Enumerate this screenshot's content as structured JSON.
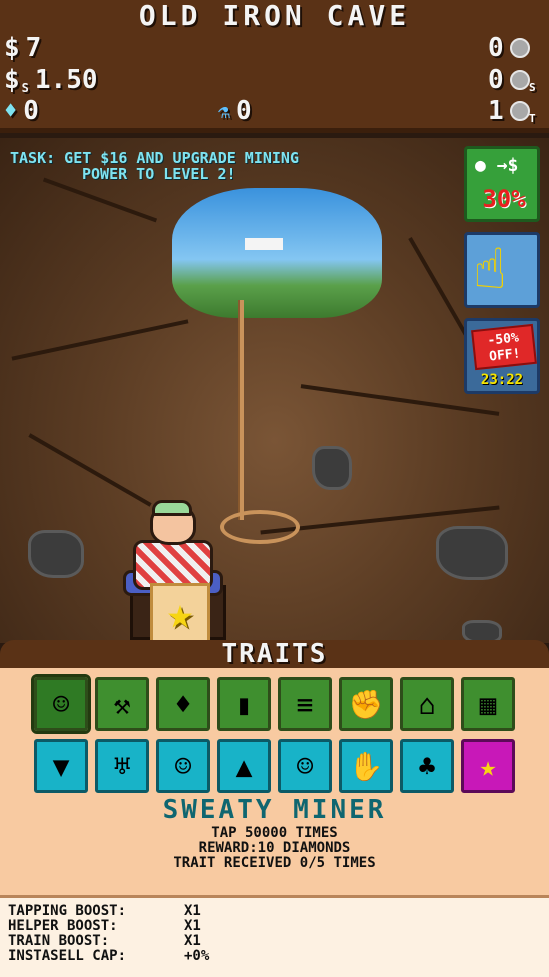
{
  "header": {
    "title": "OLD IRON CAVE"
  },
  "stats": {
    "money": {
      "symbol": "$",
      "value": "7"
    },
    "sell_price": {
      "symbol": "$",
      "sub": "S",
      "value": "1.50"
    },
    "diamonds": {
      "value": "0"
    },
    "potions": {
      "value": "0"
    },
    "ore": {
      "value": "0"
    },
    "ore_stored": {
      "value": "0",
      "sub": "S"
    },
    "ore_train": {
      "value": "1",
      "sub": "T"
    }
  },
  "task": {
    "line1": "TASK: GET $16 AND UPGRADE MINING",
    "line2": "POWER TO LEVEL 2!"
  },
  "side_buttons": {
    "sell_arrow": "→$",
    "sell_percent": "30%",
    "sale_tag": "-50%\nOFF!",
    "sale_timer": "23:22"
  },
  "traits": {
    "title": "TRAITS",
    "row1": [
      {
        "name": "sweaty-miner",
        "glyph": "☺",
        "color": "green",
        "selected": true
      },
      {
        "name": "pickaxe",
        "glyph": "⚒",
        "color": "green"
      },
      {
        "name": "diamond",
        "glyph": "♦",
        "color": "green"
      },
      {
        "name": "dynamite",
        "glyph": "▮",
        "color": "green"
      },
      {
        "name": "cash-stack",
        "glyph": "≡",
        "color": "green"
      },
      {
        "name": "muscle",
        "glyph": "✊",
        "color": "green"
      },
      {
        "name": "mine-shaft",
        "glyph": "⌂",
        "color": "green"
      },
      {
        "name": "chip",
        "glyph": "▦",
        "color": "green"
      }
    ],
    "row2": [
      {
        "name": "drill",
        "glyph": "▼",
        "color": "cyan"
      },
      {
        "name": "trophy",
        "glyph": "♅",
        "color": "cyan"
      },
      {
        "name": "miner-helper",
        "glyph": "☺",
        "color": "cyan"
      },
      {
        "name": "ore-bag",
        "glyph": "▲",
        "color": "cyan"
      },
      {
        "name": "miner-helper-2",
        "glyph": "☺",
        "color": "cyan"
      },
      {
        "name": "glove",
        "glyph": "✋",
        "color": "cyan"
      },
      {
        "name": "clover",
        "glyph": "♣",
        "color": "cyan"
      },
      {
        "name": "star",
        "glyph": "★",
        "color": "magenta"
      }
    ],
    "selected_name": "SWEATY MINER",
    "selected_desc1": "TAP 50000 TIMES",
    "selected_desc2": "REWARD:10 DIAMONDS",
    "selected_desc3": "TRAIT RECEIVED 0/5 TIMES"
  },
  "boosts": [
    {
      "label": "TAPPING BOOST:",
      "value": "X1"
    },
    {
      "label": "HELPER BOOST:",
      "value": "X1"
    },
    {
      "label": "TRAIN BOOST:",
      "value": "X1"
    },
    {
      "label": "INSTASELL CAP:",
      "value": "+0%"
    }
  ]
}
